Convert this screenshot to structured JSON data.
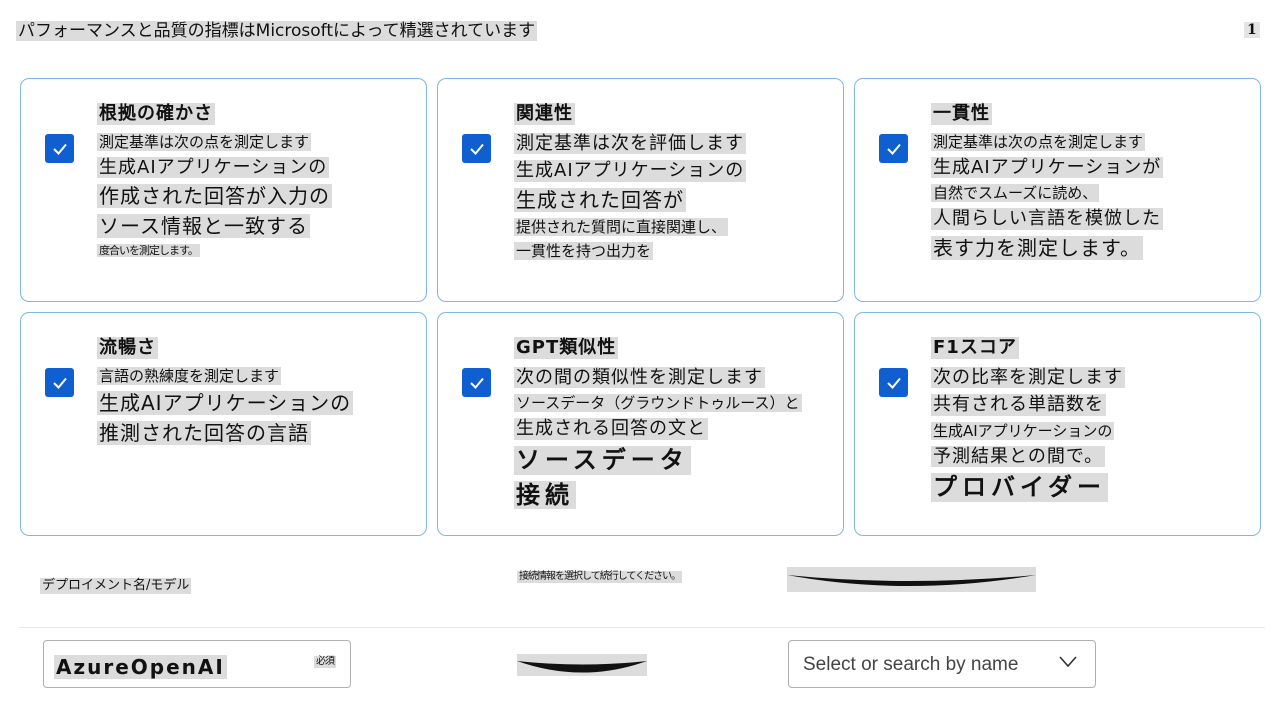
{
  "header": {
    "title": "パフォーマンスと品質の指標はMicrosoftによって精選されています",
    "page_index": "1"
  },
  "metrics": [
    {
      "title": "根拠の確かさ",
      "checked": true,
      "lines": [
        {
          "text": "測定基準は次の点を測定します",
          "size": "small"
        },
        {
          "text": "生成AIアプリケーションの",
          "size": "mid"
        },
        {
          "text": "作成された回答が入力の",
          "size": "big"
        },
        {
          "text": "ソース情報と一致する",
          "size": "big"
        },
        {
          "text": "度合いを測定します。",
          "size": "tiny"
        }
      ]
    },
    {
      "title": "関連性",
      "checked": true,
      "lines": [
        {
          "text": "測定基準は次を評価します",
          "size": "mid"
        },
        {
          "text": "生成AIアプリケーションの",
          "size": "mid"
        },
        {
          "text": "生成された回答が",
          "size": "big"
        },
        {
          "text": "提供された質問に直接関連し、",
          "size": "small"
        },
        {
          "text": "一貫性を持つ出力を",
          "size": "small"
        }
      ]
    },
    {
      "title": "一貫性",
      "checked": true,
      "lines": [
        {
          "text": "測定基準は次の点を測定します",
          "size": "small"
        },
        {
          "text": "生成AIアプリケーションが",
          "size": "mid"
        },
        {
          "text": "自然でスムーズに読め、",
          "size": "small"
        },
        {
          "text": "人間らしい言語を模倣した",
          "size": "mid"
        },
        {
          "text": "表す力を測定します。",
          "size": "big"
        }
      ]
    },
    {
      "title": "流暢さ",
      "checked": true,
      "lines": [
        {
          "text": "言語の熟練度を測定します",
          "size": "small"
        },
        {
          "text": "生成AIアプリケーションの",
          "size": "big"
        },
        {
          "text": "推測された回答の言語",
          "size": "big"
        }
      ]
    },
    {
      "title": "GPT類似性",
      "checked": true,
      "lines": [
        {
          "text": "次の間の類似性を測定します",
          "size": "mid"
        },
        {
          "text": "ソースデータ（グラウンドトゥルース）と",
          "size": "small"
        },
        {
          "text": "生成される回答の文と",
          "size": "mid"
        },
        {
          "text": "ソースデータ",
          "size": "huge"
        },
        {
          "text": "接続",
          "size": "huge"
        }
      ]
    },
    {
      "title": "F1スコア",
      "checked": true,
      "lines": [
        {
          "text": "次の比率を測定します",
          "size": "mid"
        },
        {
          "text": "共有される単語数を",
          "size": "mid"
        },
        {
          "text": "生成AIアプリケーションの",
          "size": "small"
        },
        {
          "text": "予測結果との間で。",
          "size": "mid"
        },
        {
          "text": "プロバイダー",
          "size": "huge"
        }
      ]
    }
  ],
  "deployment": {
    "label": "デプロイメント名/モデル",
    "hint": "接続情報を選択して続行してください。",
    "provider_value": "AzureOpenAI",
    "provider_required": "必須",
    "model_placeholder": "Select or search by name"
  },
  "icons": {
    "checkbox": "check-icon",
    "dropdown": "chevron-down-icon"
  },
  "colors": {
    "accent": "#0f5fd0",
    "card_border": "#7fb6e8",
    "highlight": "#dcdcdc"
  }
}
